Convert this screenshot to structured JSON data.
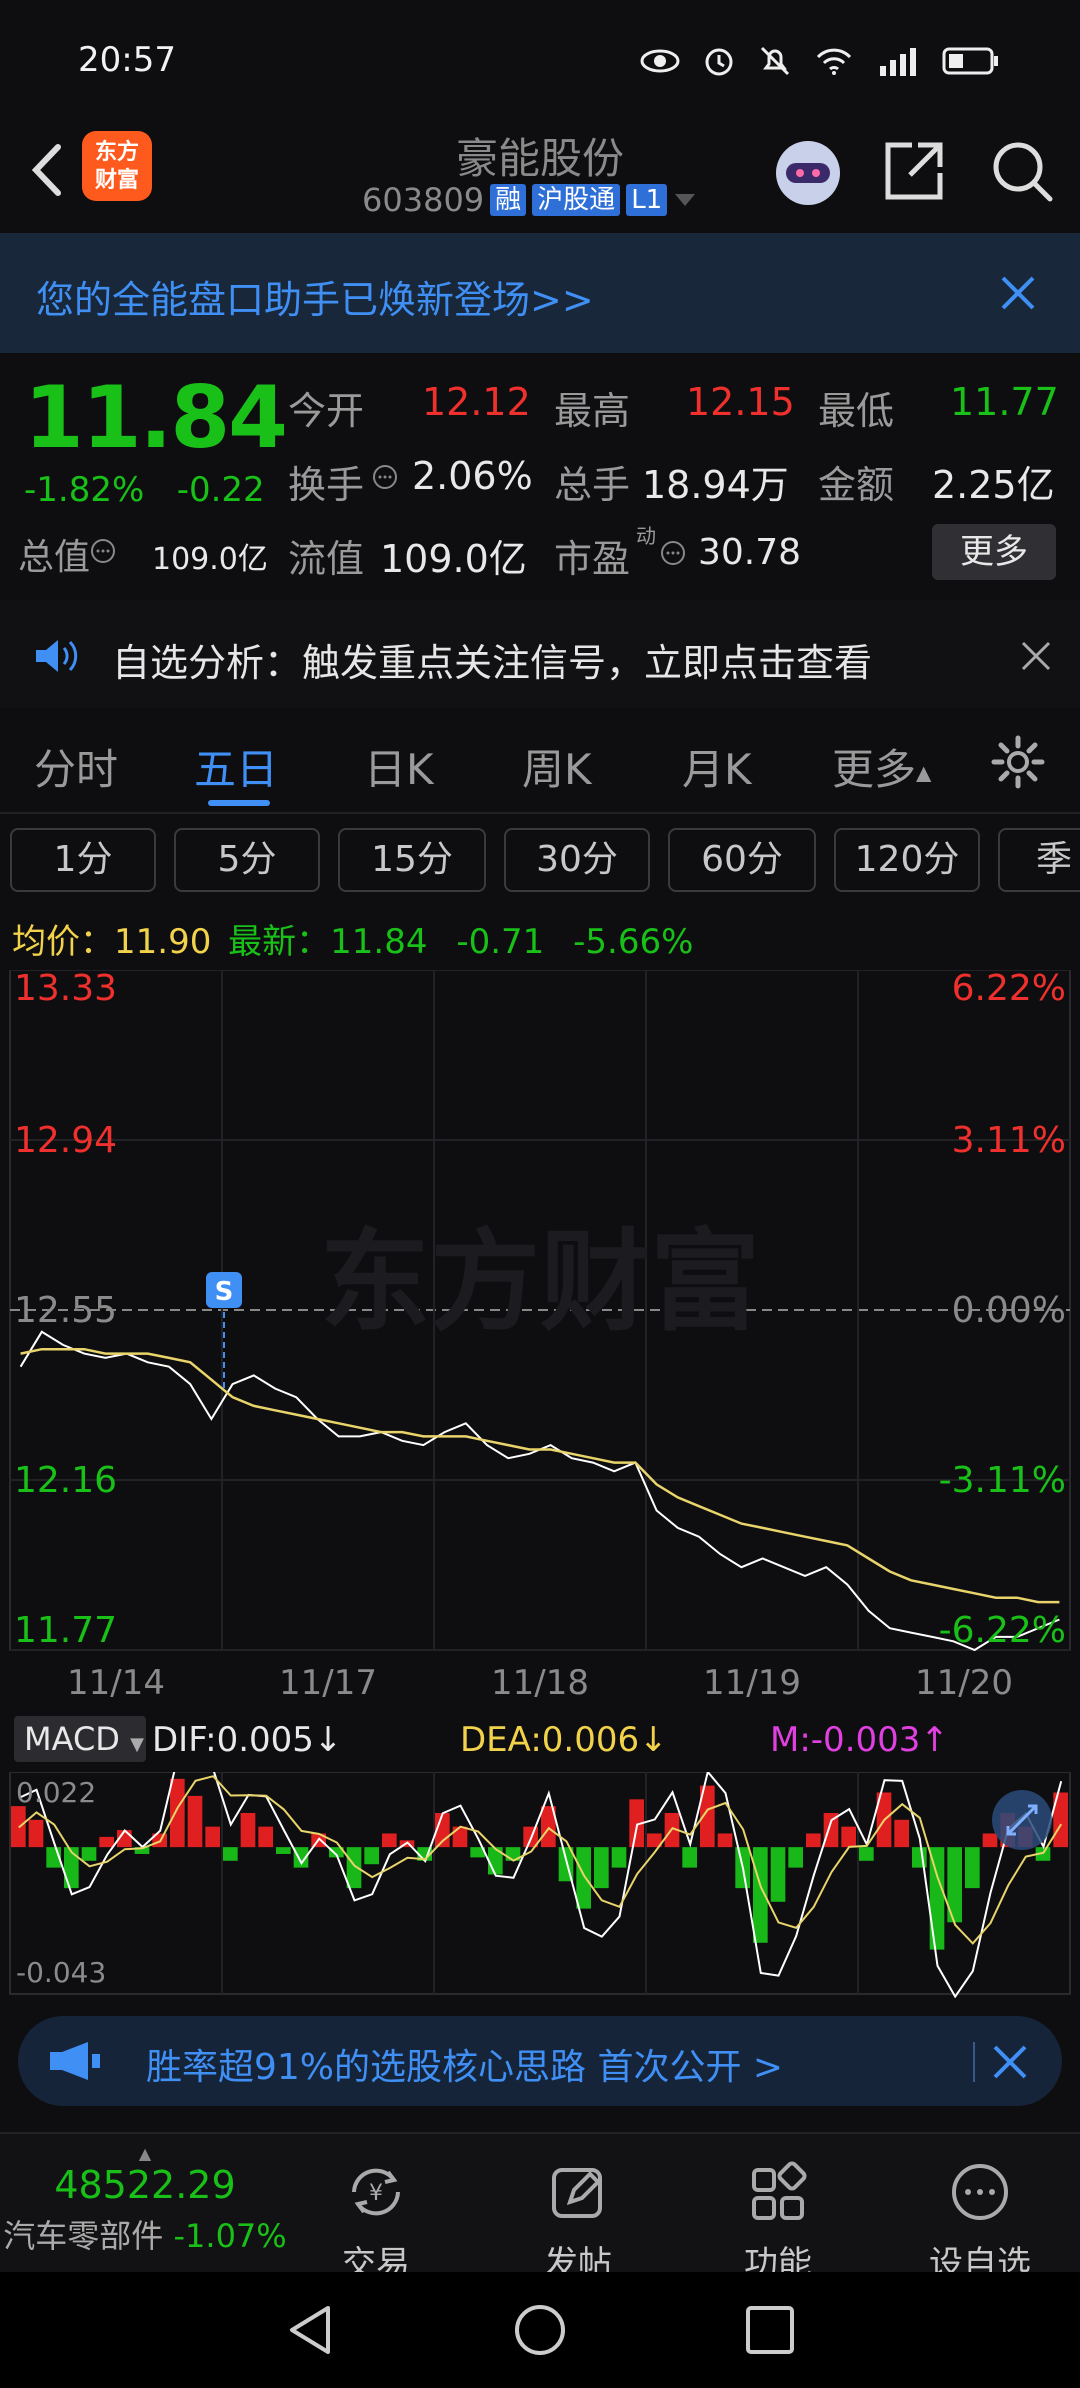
{
  "status_bar": {
    "time": "20:57"
  },
  "header": {
    "logo_text_1": "东方",
    "logo_text_2": "财富",
    "stock_name": "豪能股份",
    "stock_code": "603809",
    "tags": [
      "融",
      "沪股通",
      "L1"
    ]
  },
  "banner": {
    "text": "您的全能盘口助手已焕新登场>>"
  },
  "quote": {
    "price": "11.84",
    "change_pct": "-1.82%",
    "change_abs": "-0.22",
    "open_label": "今开",
    "open_value": "12.12",
    "high_label": "最高",
    "high_value": "12.15",
    "low_label": "最低",
    "low_value": "11.77",
    "turnover_label": "换手",
    "turnover_value": "2.06%",
    "volume_label": "总手",
    "volume_value": "18.94万",
    "amount_label": "金额",
    "amount_value": "2.25亿",
    "mcap_label": "总值",
    "mcap_value": "109.0亿",
    "float_label": "流值",
    "float_value": "109.0亿",
    "pe_label": "市盈",
    "pe_sup": "动",
    "pe_value": "30.78",
    "more_label": "更多"
  },
  "notice": {
    "text": "自选分析：触发重点关注信号，立即点击查看"
  },
  "tabs": {
    "items": [
      "分时",
      "五日",
      "日K",
      "周K",
      "月K",
      "更多"
    ],
    "active": "五日"
  },
  "periods": [
    "1分",
    "5分",
    "15分",
    "30分",
    "60分",
    "120分",
    "季"
  ],
  "legend": {
    "avg_label": "均价：",
    "avg_value": "11.90",
    "last_label": "最新：",
    "last_value": "11.84",
    "last_change": "-0.71",
    "last_pct": "-5.66%"
  },
  "chart_data": {
    "type": "line",
    "title": "",
    "x_labels": [
      "11/14",
      "11/17",
      "11/18",
      "11/19",
      "11/20"
    ],
    "y_left_ticks": [
      "13.33",
      "12.94",
      "12.55",
      "12.16",
      "11.77"
    ],
    "y_right_ticks": [
      "6.22%",
      "3.11%",
      "0.00%",
      "-3.11%",
      "-6.22%"
    ],
    "ylim": [
      11.77,
      13.33
    ],
    "prev_close": 12.55,
    "signal_marker": "S",
    "watermark": "东方财富",
    "series": [
      {
        "name": "",
        "color": "#ffffff",
        "values": [
          12.42,
          12.5,
          12.47,
          12.45,
          12.44,
          12.45,
          12.43,
          12.42,
          12.38,
          12.3,
          12.38,
          12.4,
          12.37,
          12.35,
          12.3,
          12.26,
          12.26,
          12.27,
          12.25,
          12.24,
          12.27,
          12.29,
          12.24,
          12.21,
          12.22,
          12.24,
          12.21,
          12.2,
          12.18,
          12.2,
          12.09,
          12.05,
          12.03,
          11.99,
          11.96,
          11.98,
          11.96,
          11.94,
          11.96,
          11.92,
          11.86,
          11.82,
          11.81,
          11.8,
          11.79,
          11.77,
          11.8,
          11.8,
          11.82,
          11.84
        ]
      },
      {
        "name": "",
        "color": "#e8d46a",
        "values": [
          12.45,
          12.46,
          12.46,
          12.46,
          12.45,
          12.45,
          12.45,
          12.44,
          12.43,
          12.39,
          12.35,
          12.33,
          12.32,
          12.31,
          12.3,
          12.29,
          12.28,
          12.27,
          12.27,
          12.26,
          12.26,
          12.26,
          12.25,
          12.24,
          12.23,
          12.23,
          12.22,
          12.21,
          12.2,
          12.2,
          12.15,
          12.12,
          12.1,
          12.08,
          12.06,
          12.05,
          12.04,
          12.03,
          12.02,
          12.01,
          11.98,
          11.95,
          11.93,
          11.92,
          11.91,
          11.9,
          11.89,
          11.89,
          11.88,
          11.88
        ]
      }
    ]
  },
  "macd": {
    "selector": "MACD",
    "dif": "DIF:0.005",
    "dea": "DEA:0.006",
    "m": "M:-0.003",
    "top_tick": "0.022",
    "bottom_tick": "-0.043",
    "bars": [
      0.012,
      0.008,
      -0.006,
      -0.012,
      -0.004,
      0.003,
      0.005,
      -0.002,
      0.004,
      0.02,
      0.015,
      0.006,
      -0.004,
      0.01,
      0.006,
      -0.002,
      -0.006,
      0.004,
      -0.003,
      -0.012,
      -0.005,
      0.004,
      0.002,
      -0.004,
      0.01,
      0.006,
      -0.003,
      -0.008,
      -0.004,
      0.006,
      0.012,
      -0.01,
      -0.018,
      -0.012,
      -0.006,
      0.014,
      0.004,
      0.01,
      -0.006,
      0.018,
      0.004,
      -0.012,
      -0.028,
      -0.016,
      -0.006,
      0.004,
      0.01,
      0.006,
      -0.004,
      0.016,
      0.008,
      -0.006,
      -0.03,
      -0.022,
      -0.012,
      0.004,
      0.01,
      0.006,
      -0.004,
      0.016
    ]
  },
  "ad": {
    "text": "胜率超91%的选股核心思路 首次公开 >"
  },
  "bottom_nav": {
    "index_value": "48522.29",
    "index_name": "汽车零部件",
    "index_change": "-1.07%",
    "items": [
      "交易",
      "发帖",
      "功能",
      "设自选"
    ]
  }
}
